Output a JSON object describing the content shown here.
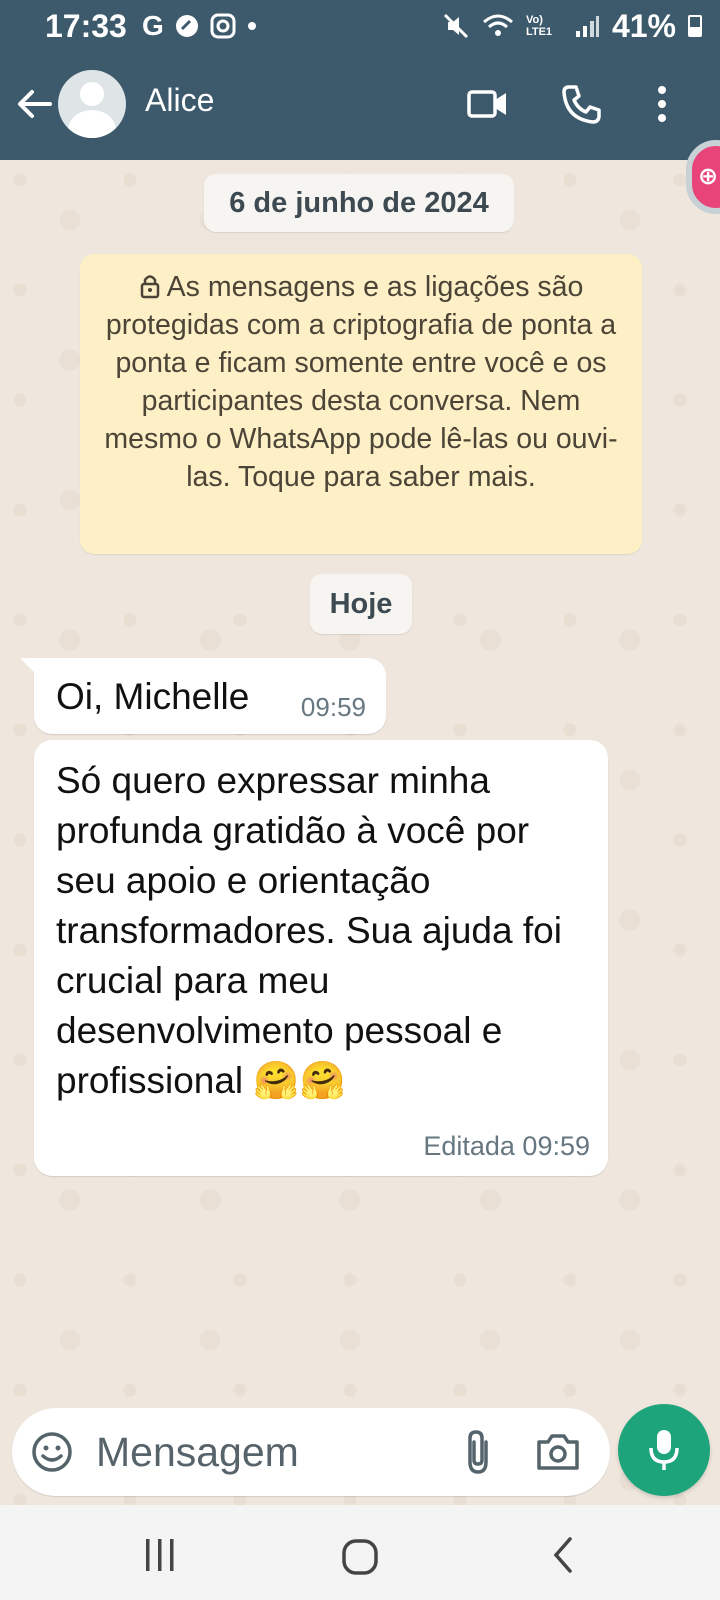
{
  "status_bar": {
    "time": "17:33",
    "network_letter": "G",
    "battery": "41%",
    "signal_label": "Vo) LTE1"
  },
  "header": {
    "contact_name": "Alice",
    "icons": [
      "back-arrow-icon",
      "video-call-icon",
      "phone-icon",
      "more-vert-icon"
    ]
  },
  "chat": {
    "date_pill": "6 de junho de 2024",
    "encryption_notice": "As mensagens e as ligações são protegidas com a criptografia de ponta a ponta e ficam somente entre você e os participantes desta conversa. Nem mesmo o WhatsApp pode lê-las ou ouvi-las. Toque para saber mais.",
    "today_pill": "Hoje",
    "messages": [
      {
        "text": "Oi, Michelle",
        "time": "09:59"
      },
      {
        "text": "Só quero expressar minha profunda gratidão à você por seu apoio e orientação transformadores. Sua ajuda foi crucial para meu desenvolvimento pessoal e profissional 🤗🤗",
        "time": "Editada 09:59"
      }
    ]
  },
  "composer": {
    "placeholder": "Mensagem"
  },
  "colors": {
    "header": "#3d5a6c",
    "accent_green": "#1ea47a",
    "encryption_bg": "#fdefc6"
  }
}
